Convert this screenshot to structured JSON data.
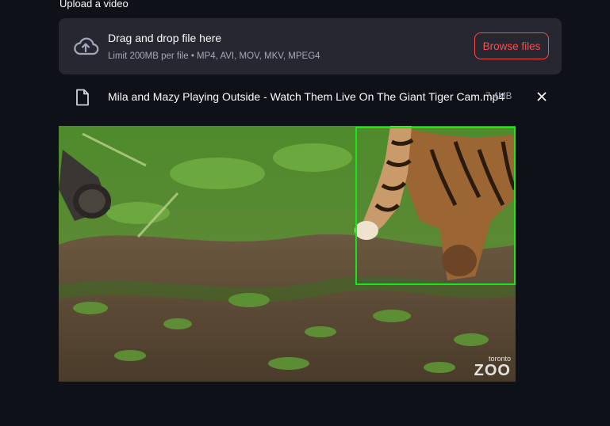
{
  "uploader": {
    "label": "Upload a video",
    "drop_title": "Drag and drop file here",
    "limit_text": "Limit 200MB per file • MP4, AVI, MOV, MKV, MPEG4",
    "browse_label": "Browse files"
  },
  "file": {
    "name": "Mila and Mazy Playing Outside - Watch Them Live On The Giant Tiger Cam.mp4",
    "size": "7.4MB"
  },
  "video": {
    "watermark_small": "toronto",
    "watermark_big": "ZOO"
  },
  "colors": {
    "background": "#0e1117",
    "dropzone": "#262730",
    "accent": "#ff4b4b",
    "detection_box": "#19e619"
  },
  "icons": [
    "cloud-upload-icon",
    "file-icon",
    "close-icon"
  ]
}
